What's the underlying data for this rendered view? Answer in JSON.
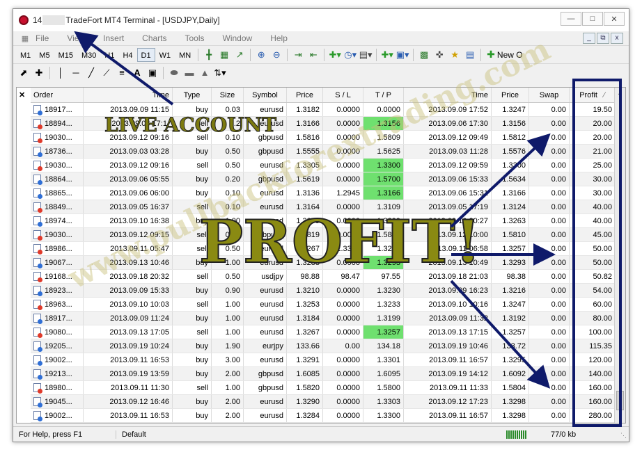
{
  "window": {
    "title_prefix": "14",
    "title_suffix": "TradeFort MT4 Terminal - [USDJPY,Daily]"
  },
  "menu": [
    "File",
    "View",
    "Insert",
    "Charts",
    "Tools",
    "Window",
    "Help"
  ],
  "timeframes": [
    "M1",
    "M5",
    "M15",
    "M30",
    "H1",
    "H4",
    "D1",
    "W1",
    "MN"
  ],
  "active_timeframe": "D1",
  "toolbar": {
    "new_order_label": "New O"
  },
  "table": {
    "headers": [
      "Order",
      "Time",
      "Type",
      "Size",
      "Symbol",
      "Price",
      "S / L",
      "T / P",
      "Time",
      "Price",
      "Swap",
      "Profit"
    ],
    "rows": [
      [
        "18917...",
        "2013.09.09 11:15",
        "buy",
        "0.03",
        "eurusd",
        "1.3182",
        "0.0000",
        "0.0000",
        "2013.09.09 17:52",
        "1.3247",
        "0.00",
        "19.50"
      ],
      [
        "18894...",
        "2013.09.06 17:1.",
        "sell",
        "0.2",
        "eurusd",
        "1.3166",
        "0.0000",
        "1.3156",
        "2013.09.06 17:30",
        "1.3156",
        "0.00",
        "20.00"
      ],
      [
        "19030...",
        "2013.09.12 09:16",
        "sell",
        "0.10",
        "gbpusd",
        "1.5816",
        "0.0000",
        "1.5809",
        "2013.09.12 09:49",
        "1.5812",
        "0.00",
        "20.00"
      ],
      [
        "18736...",
        "2013.09.03 03:28",
        "buy",
        "0.50",
        "gbpusd",
        "1.5555",
        "0.0000",
        "1.5625",
        "2013.09.03 11:28",
        "1.5576",
        "0.00",
        "21.00"
      ],
      [
        "19030...",
        "2013.09.12 09:16",
        "sell",
        "0.50",
        "eurusd",
        "1.3305",
        "0.0000",
        "1.3300",
        "2013.09.12 09:59",
        "1.3300",
        "0.00",
        "25.00"
      ],
      [
        "18864...",
        "2013.09.06 05:55",
        "buy",
        "0.20",
        "gbpusd",
        "1.5619",
        "0.0000",
        "1.5700",
        "2013.09.06 15:33",
        "1.5634",
        "0.00",
        "30.00"
      ],
      [
        "18865...",
        "2013.09.06 06:00",
        "buy",
        "0.10",
        "eurusd",
        "1.3136",
        "1.2945",
        "1.3166",
        "2013.09.06 15:31",
        "1.3166",
        "0.00",
        "30.00"
      ],
      [
        "18849...",
        "2013.09.05 16:37",
        "sell",
        "0.10",
        "eurusd",
        "1.3164",
        "0.0000",
        "1.3109",
        "2013.09.05 17:19",
        "1.3124",
        "0.00",
        "40.00"
      ],
      [
        "18974...",
        "2013.09.10 16:38",
        "buy",
        "1.00",
        "eurusd",
        "1.3259",
        "0.0000",
        "1.3299",
        "2013.09.10 20:27",
        "1.3263",
        "0.00",
        "40.00"
      ],
      [
        "19030...",
        "2013.09.12 09:15",
        "sell",
        "0.50",
        "gbpusd",
        "1.5819",
        "0.0000",
        "1.5810",
        "2013.09.12 10:00",
        "1.5810",
        "0.00",
        "45.00"
      ],
      [
        "18986...",
        "2013.09.11 05:47",
        "sell",
        "0.50",
        "eurusd",
        "1.3267",
        "1.3383",
        "1.3247",
        "2013.09.11 06:58",
        "1.3257",
        "0.00",
        "50.00"
      ],
      [
        "19067...",
        "2013.09.13 10:46",
        "buy",
        "1.00",
        "eurusd",
        "1.3288",
        "0.0000",
        "1.3293",
        "2013.09.13 10:49",
        "1.3293",
        "0.00",
        "50.00"
      ],
      [
        "19168...",
        "2013.09.18 20:32",
        "sell",
        "0.50",
        "usdjpy",
        "98.88",
        "98.47",
        "97.55",
        "2013.09.18 21:03",
        "98.38",
        "0.00",
        "50.82"
      ],
      [
        "18923...",
        "2013.09.09 15:33",
        "buy",
        "0.90",
        "eurusd",
        "1.3210",
        "0.0000",
        "1.3230",
        "2013.09.09 16:23",
        "1.3216",
        "0.00",
        "54.00"
      ],
      [
        "18963...",
        "2013.09.10 10:03",
        "sell",
        "1.00",
        "eurusd",
        "1.3253",
        "0.0000",
        "1.3233",
        "2013.09.10 10:16",
        "1.3247",
        "0.00",
        "60.00"
      ],
      [
        "18917...",
        "2013.09.09 11:24",
        "buy",
        "1.00",
        "eurusd",
        "1.3184",
        "0.0000",
        "1.3199",
        "2013.09.09 11:32",
        "1.3192",
        "0.00",
        "80.00"
      ],
      [
        "19080...",
        "2013.09.13 17:05",
        "sell",
        "1.00",
        "eurusd",
        "1.3267",
        "0.0000",
        "1.3257",
        "2013.09.13 17:15",
        "1.3257",
        "0.00",
        "100.00"
      ],
      [
        "19205...",
        "2013.09.19 10:24",
        "buy",
        "1.90",
        "eurjpy",
        "133.66",
        "0.00",
        "134.18",
        "2013.09.19 10:46",
        "133.72",
        "0.00",
        "115.35"
      ],
      [
        "19002...",
        "2013.09.11 16:53",
        "buy",
        "3.00",
        "eurusd",
        "1.3291",
        "0.0000",
        "1.3301",
        "2013.09.11 16:57",
        "1.3295",
        "0.00",
        "120.00"
      ],
      [
        "19213...",
        "2013.09.19 13:59",
        "buy",
        "2.00",
        "gbpusd",
        "1.6085",
        "0.0000",
        "1.6095",
        "2013.09.19 14:12",
        "1.6092",
        "0.00",
        "140.00"
      ],
      [
        "18980...",
        "2013.09.11 11:30",
        "sell",
        "1.00",
        "gbpusd",
        "1.5820",
        "0.0000",
        "1.5800",
        "2013.09.11 11:33",
        "1.5804",
        "0.00",
        "160.00"
      ],
      [
        "19045...",
        "2013.09.12 16:46",
        "buy",
        "2.00",
        "eurusd",
        "1.3290",
        "0.0000",
        "1.3303",
        "2013.09.12 17:23",
        "1.3298",
        "0.00",
        "160.00"
      ],
      [
        "19002...",
        "2013.09.11 16:53",
        "buy",
        "2.00",
        "eurusd",
        "1.3284",
        "0.0000",
        "1.3300",
        "2013.09.11 16:57",
        "1.3298",
        "0.00",
        "280.00"
      ]
    ],
    "tp_highlight_rows": [
      1,
      4,
      5,
      6,
      11,
      16
    ]
  },
  "status": {
    "help": "For Help, press F1",
    "profile": "Default",
    "traffic": "77/0 kb"
  },
  "annotations": {
    "live_account": "LIVE ACCOUNT",
    "profit": "PROFIT!",
    "watermark": "www.pullbackforextrading.com",
    "colors": {
      "annotation_text": "#7c7a10",
      "arrow": "#0f1a6a",
      "tp_hit": "#6fe06f"
    }
  }
}
